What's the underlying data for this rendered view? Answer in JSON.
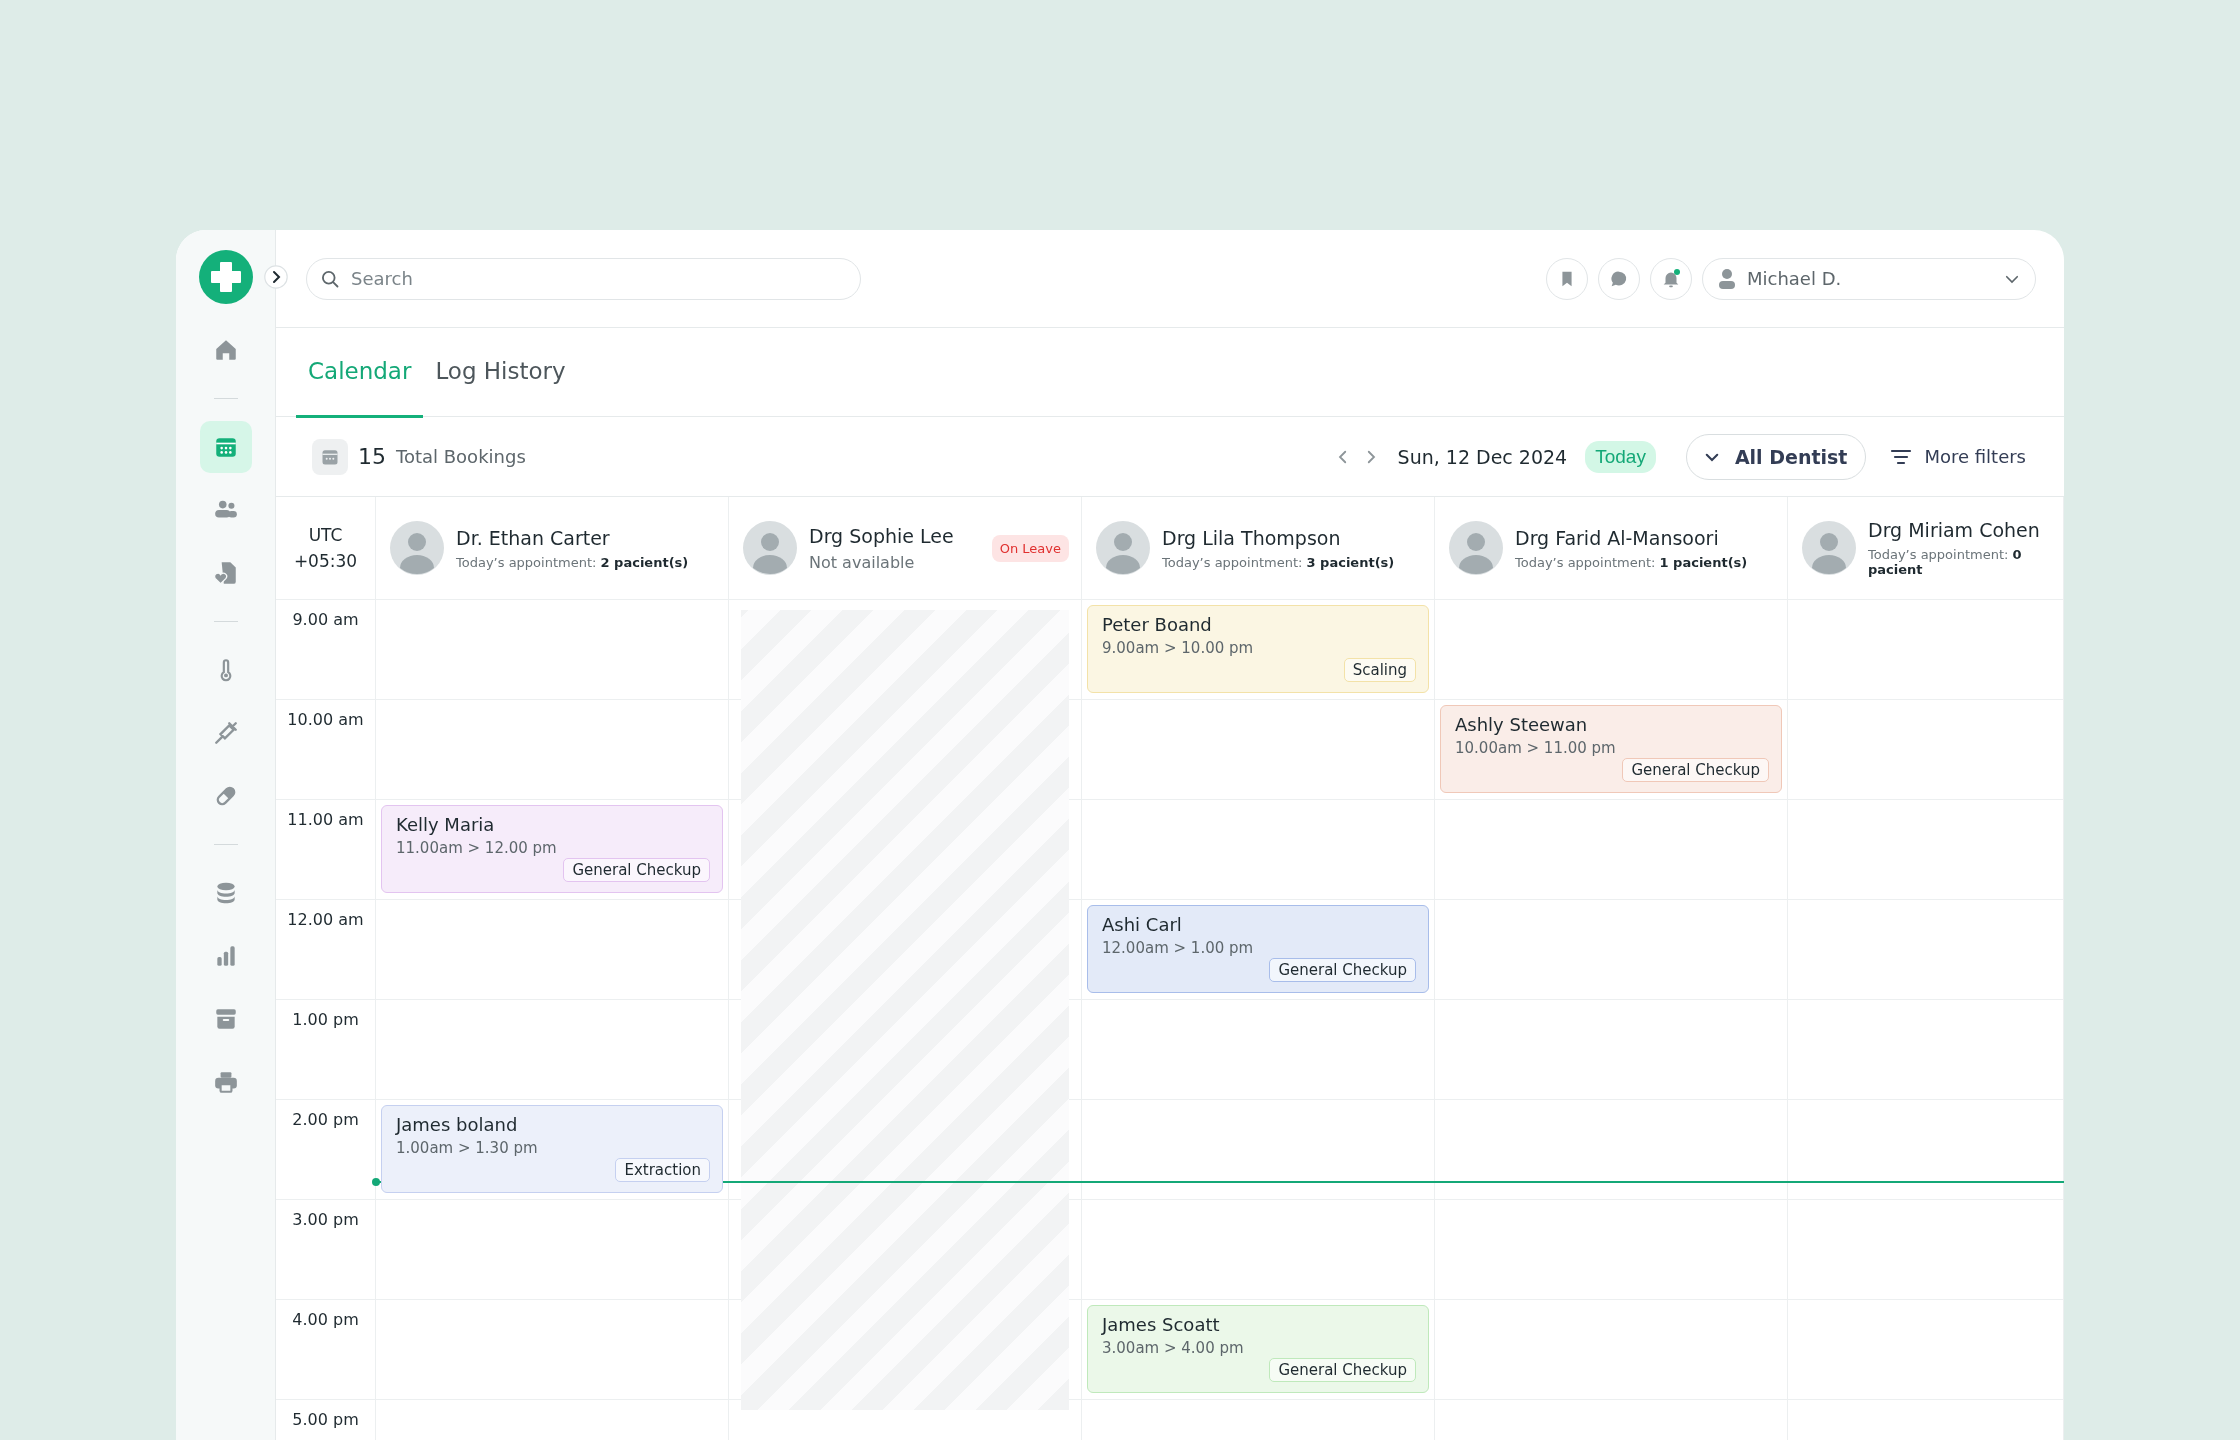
{
  "sidebar": {
    "groups": [
      {
        "items": [
          {
            "kind": "home",
            "selected": false
          }
        ]
      },
      {
        "items": [
          {
            "kind": "calendar",
            "selected": true
          },
          {
            "kind": "people",
            "selected": false
          },
          {
            "kind": "records",
            "selected": false
          }
        ]
      },
      {
        "items": [
          {
            "kind": "thermometer",
            "selected": false
          },
          {
            "kind": "syringe",
            "selected": false
          },
          {
            "kind": "pill",
            "selected": false
          }
        ]
      },
      {
        "items": [
          {
            "kind": "database",
            "selected": false
          },
          {
            "kind": "chart",
            "selected": false
          },
          {
            "kind": "archive",
            "selected": false
          },
          {
            "kind": "printer",
            "selected": false
          }
        ]
      }
    ]
  },
  "topbar": {
    "search": {
      "placeholder": "Search"
    },
    "actions": [
      {
        "kind": "bookmark",
        "has_notification": false
      },
      {
        "kind": "chat",
        "has_notification": false
      },
      {
        "kind": "bell",
        "has_notification": true
      }
    ],
    "user": {
      "name": "Michael D."
    }
  },
  "tabs": [
    {
      "label": "Calendar",
      "selected": true
    },
    {
      "label": "Log History",
      "selected": false
    }
  ],
  "toolbar": {
    "total_count": "15",
    "total_label": "Total Bookings",
    "date": "Sun, 12 Dec 2024",
    "today_label": "Today",
    "dentist_filter": "All Dentist",
    "more_filters": "More filters"
  },
  "time_zone": {
    "label": "UTC",
    "offset": "+05:30"
  },
  "hours": [
    "9.00 am",
    "10.00 am",
    "11.00 am",
    "12.00 am",
    "1.00 pm",
    "2.00 pm",
    "3.00 pm",
    "4.00 pm",
    "5.00 pm"
  ],
  "doctors": [
    {
      "name": "Dr. Ethan Carter",
      "on_leave": false,
      "subtitle": "Today’s appointment: **2 pacient(s)**",
      "slots": [
        {
          "kind": "empty"
        },
        {
          "kind": "empty"
        },
        {
          "kind": "appointment",
          "patient": "Kelly Maria",
          "time": "11.00am > 12.00 pm",
          "treatment": "General Checkup",
          "color": "#e3c4f0"
        },
        {
          "kind": "empty"
        },
        {
          "kind": "empty"
        },
        {
          "kind": "appointment",
          "patient": "James boland",
          "time": "1.00am > 1.30 pm",
          "treatment": "Extraction",
          "color": "#c5d0f0"
        }
      ]
    },
    {
      "name": "Drg Sophie Lee",
      "on_leave": true,
      "subtitle": "Not available",
      "badge": "On Leave"
    },
    {
      "name": "Drg Lila Thompson",
      "on_leave": false,
      "subtitle": "Today’s appointment: **3 pacient(s)**",
      "slots": [
        {
          "kind": "appointment",
          "patient": "Peter Boand",
          "time": "9.00am > 10.00 pm",
          "treatment": "Scaling",
          "color": "#f3e2a8"
        },
        {
          "kind": "empty"
        },
        {
          "kind": "empty"
        },
        {
          "kind": "appointment",
          "patient": "Ashi Carl",
          "time": "12.00am > 1.00 pm",
          "treatment": "General Checkup",
          "color": "#a8bdea"
        },
        {
          "kind": "empty"
        },
        {
          "kind": "empty"
        },
        {
          "kind": "empty"
        },
        {
          "kind": "appointment",
          "patient": "James Scoatt",
          "time": "3.00am > 4.00 pm",
          "treatment": "General Checkup",
          "color": "#bfe9bb"
        }
      ]
    },
    {
      "name": "Drg Farid Al-Mansoori",
      "on_leave": false,
      "subtitle": "Today’s appointment: **1 pacient(s)**",
      "slots": [
        {
          "kind": "empty"
        },
        {
          "kind": "appointment",
          "patient": "Ashly Steewan",
          "time": "10.00am > 11.00 pm",
          "treatment": "General Checkup",
          "color": "#f0c8b8"
        }
      ]
    },
    {
      "name": "Drg Miriam Cohen",
      "on_leave": false,
      "subtitle": "Today’s appointment: **0 pacient**"
    }
  ]
}
